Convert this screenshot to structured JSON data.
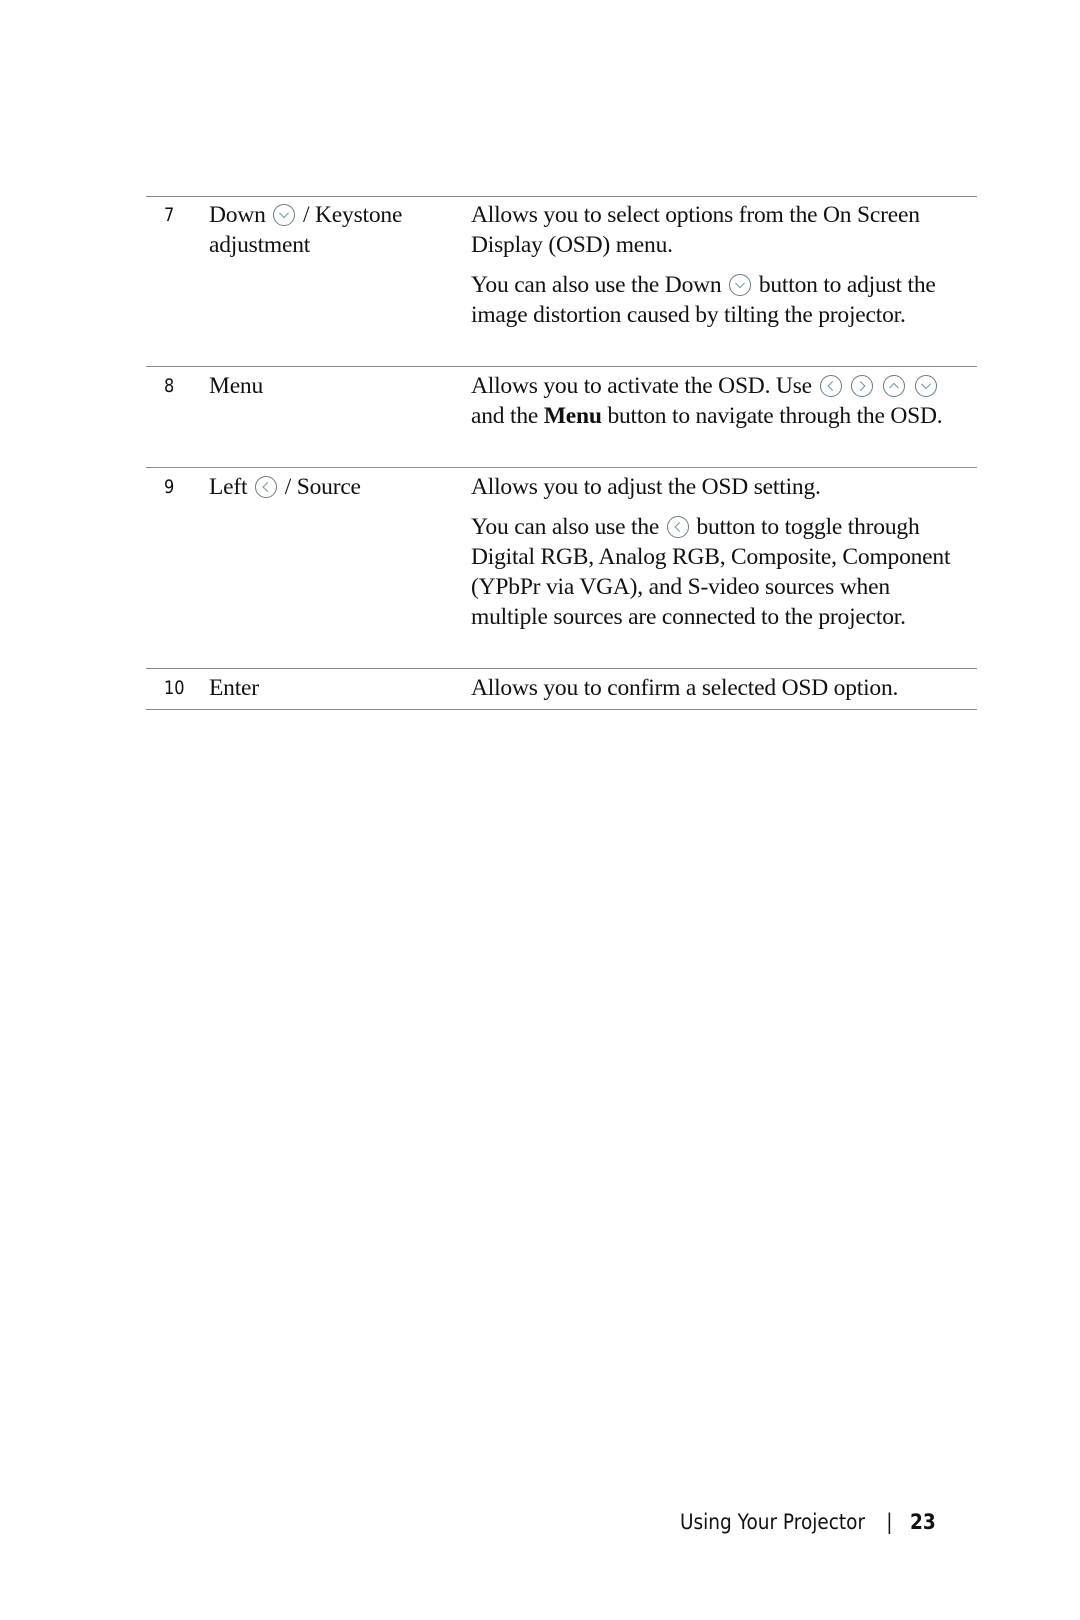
{
  "rows": [
    {
      "num": "7",
      "name_a": "Down",
      "name_b": "/ Keystone adjustment",
      "d1": "Allows you to select options from the On Screen Display (OSD) menu.",
      "d2a": "You can also use the Down",
      "d2b": "button to adjust the image distortion caused by tilting the projector."
    },
    {
      "num": "8",
      "name": "Menu",
      "d1a": "Allows you to activate the OSD. Use",
      "d1b": "and the",
      "d1bold": "Menu",
      "d1c": "button to navigate through the OSD."
    },
    {
      "num": "9",
      "name_a": "Left",
      "name_b": "/ Source",
      "d1": "Allows you to adjust the OSD setting.",
      "d2a": "You can also use the",
      "d2b": "button to toggle through Digital RGB, Analog RGB, Composite, Component (YPbPr via VGA), and S-video sources when multiple sources are connected to the projector."
    },
    {
      "num": "10",
      "name": "Enter",
      "d1": "Allows you to confirm a selected OSD option."
    }
  ],
  "icons": [
    "down-button-icon",
    "left-button-icon",
    "right-button-icon",
    "up-button-icon"
  ],
  "footer": {
    "section": "Using Your Projector",
    "separator": "|",
    "page": "23"
  }
}
